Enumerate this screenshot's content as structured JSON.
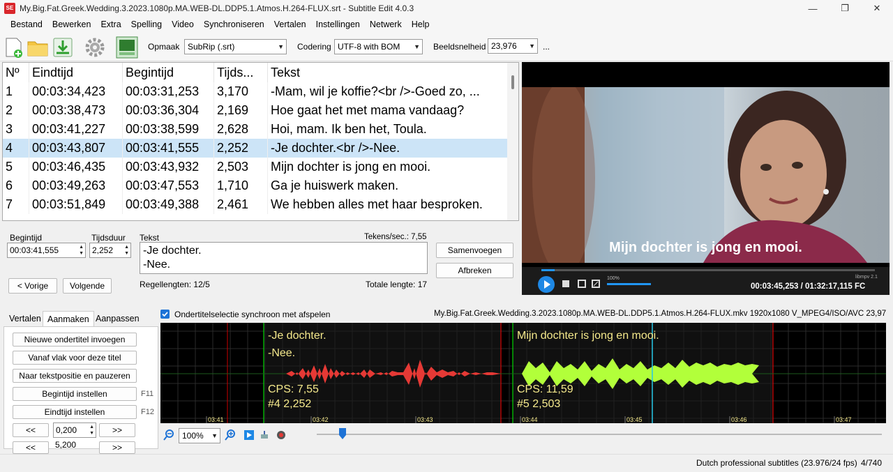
{
  "window": {
    "icon_text": "SE",
    "title": "My.Big.Fat.Greek.Wedding.3.2023.1080p.MA.WEB-DL.DDP5.1.Atmos.H.264-FLUX.srt - Subtitle Edit 4.0.3"
  },
  "menu": [
    "Bestand",
    "Bewerken",
    "Extra",
    "Spelling",
    "Video",
    "Synchroniseren",
    "Vertalen",
    "Instellingen",
    "Netwerk",
    "Help"
  ],
  "toolbar": {
    "format_label": "Opmaak",
    "format_value": "SubRip (.srt)",
    "encoding_label": "Codering",
    "encoding_value": "UTF-8 with BOM",
    "framerate_label": "Beeldsnelheid",
    "framerate_value": "23,976",
    "more": "..."
  },
  "table": {
    "headers": [
      "Nº",
      "Eindtijd",
      "Begintijd",
      "Tijds...",
      "Tekst"
    ],
    "rows": [
      {
        "n": "1",
        "end": "00:03:34,423",
        "start": "00:03:31,253",
        "dur": "3,170",
        "text": "-Mam, wil je koffie?<br />-Goed zo, ..."
      },
      {
        "n": "2",
        "end": "00:03:38,473",
        "start": "00:03:36,304",
        "dur": "2,169",
        "text": "Hoe gaat het met mama vandaag?"
      },
      {
        "n": "3",
        "end": "00:03:41,227",
        "start": "00:03:38,599",
        "dur": "2,628",
        "text": "Hoi, mam. Ik ben het, Toula."
      },
      {
        "n": "4",
        "end": "00:03:43,807",
        "start": "00:03:41,555",
        "dur": "2,252",
        "text": "-Je dochter.<br />-Nee."
      },
      {
        "n": "5",
        "end": "00:03:46,435",
        "start": "00:03:43,932",
        "dur": "2,503",
        "text": "Mijn dochter is jong en mooi."
      },
      {
        "n": "6",
        "end": "00:03:49,263",
        "start": "00:03:47,553",
        "dur": "1,710",
        "text": "Ga je huiswerk maken."
      },
      {
        "n": "7",
        "end": "00:03:51,849",
        "start": "00:03:49,388",
        "dur": "2,461",
        "text": "We hebben alles met haar besproken."
      }
    ],
    "selected_index": 3
  },
  "editor": {
    "start_label": "Begintijd",
    "start_value": "00:03:41,555",
    "duration_label": "Tijdsduur",
    "duration_value": "2,252",
    "text_label": "Tekst",
    "cps_label": "Tekens/sec.: 7,55",
    "text_line1": "-Je dochter.",
    "text_line2": "-Nee.",
    "line_lengths": "Regellengten: 12/5",
    "total_length": "Totale lengte: 17",
    "prev_button": "< Vorige",
    "next_button": "Volgende",
    "merge_button": "Samenvoegen",
    "split_button": "Afbreken"
  },
  "video": {
    "subtitle": "Mijn dochter is jong en mooi.",
    "volume": "100%",
    "time": "00:03:45,253 / 01:32:17,115 FC",
    "lib": "libmpv 2.1",
    "position_fraction": 0.04
  },
  "tabs": [
    "Vertalen",
    "Aanmaken",
    "Aanpassen"
  ],
  "create_panel": {
    "buttons": [
      "Nieuwe ondertitel invoegen",
      "Vanaf vlak voor deze titel",
      "Naar tekstpositie en pauzeren",
      "Begintijd instellen",
      "Eindtijd instellen"
    ],
    "fkeys": [
      "F11",
      "F12"
    ],
    "step_value1": "0,200",
    "step_value2": "5,200",
    "back_label": "<<",
    "fwd_label": ">>"
  },
  "waveform": {
    "sync_checkbox_label": "Ondertitelselectie synchroon met afspelen",
    "media_info": "My.Big.Fat.Greek.Wedding.3.2023.1080p.MA.WEB-DL.DDP5.1.Atmos.H.264-FLUX.mkv 1920x1080 V_MPEG4/ISO/AVC 23,976",
    "sub4_line1": "-Je dochter.",
    "sub4_line2": "-Nee.",
    "sub4_cps": "CPS: 7,55",
    "sub4_info": "#4  2,252",
    "sub5_line1": "Mijn dochter is jong en mooi.",
    "sub5_cps": "CPS: 11,59",
    "sub5_info": "#5  2,503",
    "ticks": [
      "03:41",
      "03:42",
      "03:43",
      "03:44",
      "03:45",
      "03:46",
      "03:47"
    ],
    "zoom": "100%"
  },
  "status": {
    "profile": "Dutch professional subtitles (23.976/24 fps)",
    "position": "4/740"
  },
  "colors": {
    "selected_row": "#cce4f7",
    "wave_selected": "#e53935",
    "wave_other": "#b2ff3a",
    "wave_text": "#f5e98c",
    "accent": "#2196f3"
  }
}
